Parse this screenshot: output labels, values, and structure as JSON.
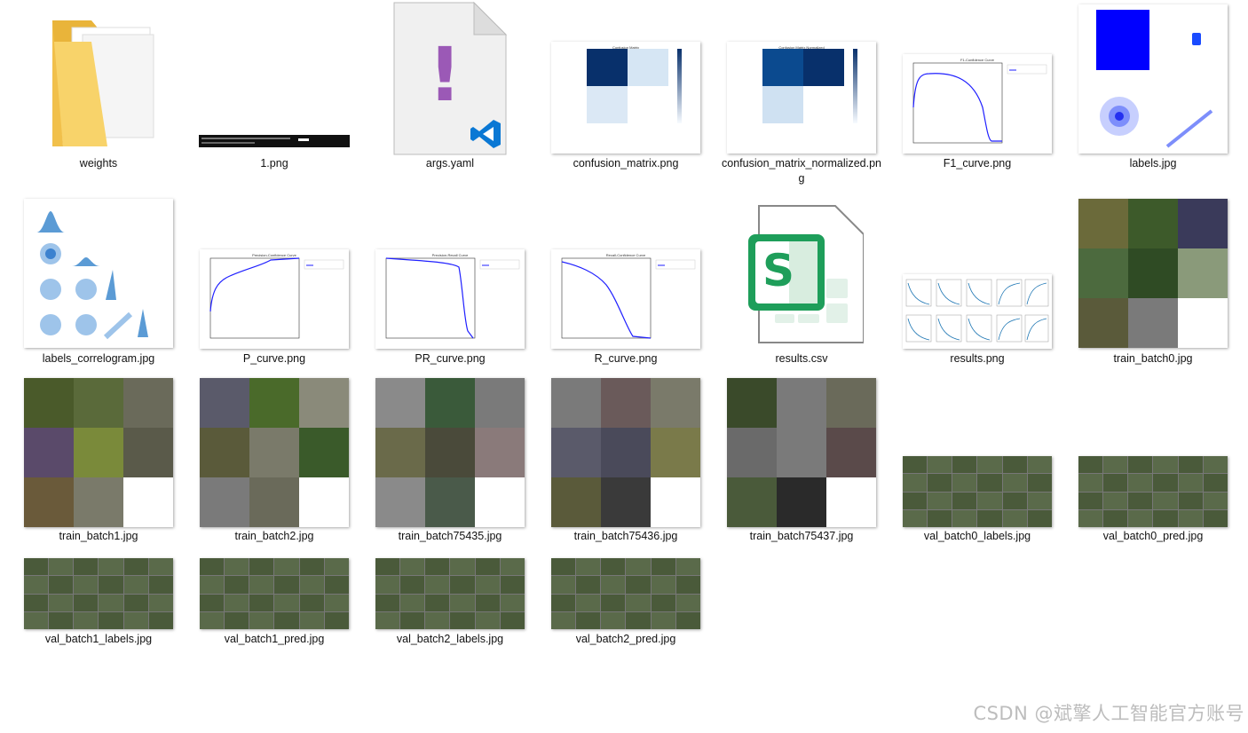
{
  "files": [
    {
      "name": "weights",
      "kind": "folder"
    },
    {
      "name": "1.png",
      "kind": "terminal"
    },
    {
      "name": "args.yaml",
      "kind": "yaml"
    },
    {
      "name": "confusion_matrix.png",
      "kind": "matrix"
    },
    {
      "name": "confusion_matrix_normalized.png",
      "kind": "matrix-norm"
    },
    {
      "name": "F1_curve.png",
      "kind": "curve-f1"
    },
    {
      "name": "labels.jpg",
      "kind": "labels"
    },
    {
      "name": "labels_correlogram.jpg",
      "kind": "correlogram"
    },
    {
      "name": "P_curve.png",
      "kind": "curve-p"
    },
    {
      "name": "PR_curve.png",
      "kind": "curve-pr"
    },
    {
      "name": "R_curve.png",
      "kind": "curve-r"
    },
    {
      "name": "results.csv",
      "kind": "csv"
    },
    {
      "name": "results.png",
      "kind": "results"
    },
    {
      "name": "train_batch0.jpg",
      "kind": "mosaic-tall"
    },
    {
      "name": "train_batch1.jpg",
      "kind": "mosaic"
    },
    {
      "name": "train_batch2.jpg",
      "kind": "mosaic"
    },
    {
      "name": "train_batch75435.jpg",
      "kind": "mosaic"
    },
    {
      "name": "train_batch75436.jpg",
      "kind": "mosaic"
    },
    {
      "name": "train_batch75437.jpg",
      "kind": "mosaic"
    },
    {
      "name": "val_batch0_labels.jpg",
      "kind": "val"
    },
    {
      "name": "val_batch0_pred.jpg",
      "kind": "val"
    },
    {
      "name": "val_batch1_labels.jpg",
      "kind": "val"
    },
    {
      "name": "val_batch1_pred.jpg",
      "kind": "val"
    },
    {
      "name": "val_batch2_labels.jpg",
      "kind": "val"
    },
    {
      "name": "val_batch2_pred.jpg",
      "kind": "val"
    }
  ],
  "curve_titles": {
    "f1": "F1-Confidence Curve",
    "p": "Precision-Confidence Curve",
    "pr": "Precision-Recall Curve",
    "r": "Recall-Confidence Curve"
  },
  "matrix_titles": {
    "plain": "Confusion Matrix",
    "normalized": "Confusion Matrix Normalized"
  },
  "yaml_glyph": "!",
  "csv_glyph": "S",
  "watermark": "CSDN @斌擎人工智能官方账号",
  "colors": {
    "folder": "#f6c84a",
    "blue_curve": "#1f1fff",
    "matrix_dark": "#08306b",
    "matrix_light": "#c6dbef",
    "csv_green": "#1e9e5a",
    "yaml_purple": "#9b59b6",
    "vscode_blue": "#007acc"
  }
}
